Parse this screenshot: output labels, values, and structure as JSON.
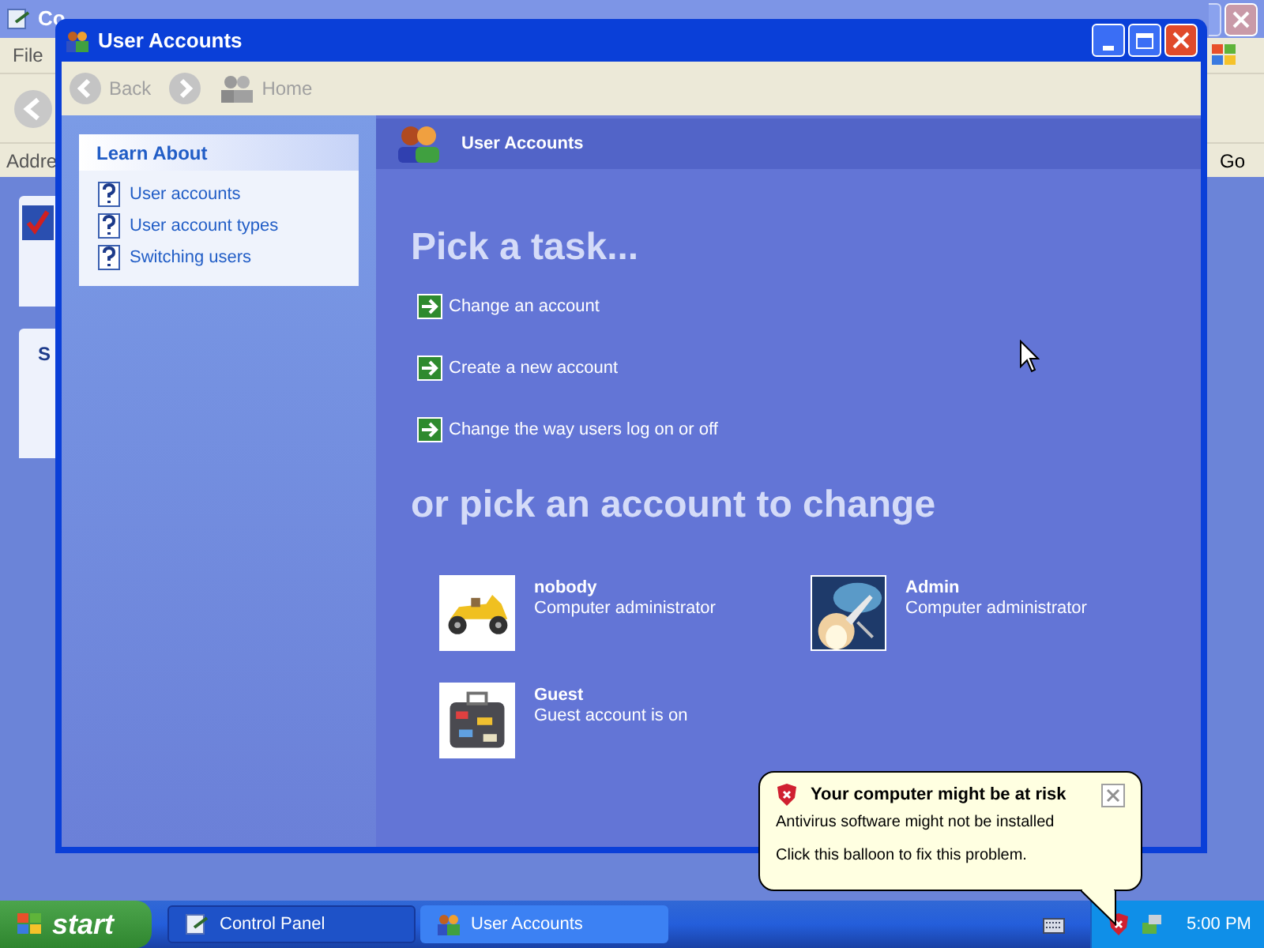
{
  "background_window": {
    "title": "Co",
    "menu": [
      "File"
    ],
    "address_label": "Addre",
    "go_button": "Go",
    "panel_heading": "S"
  },
  "window": {
    "title": "User Accounts",
    "toolbar": [
      {
        "kind": "back",
        "label": "Back",
        "disabled": true
      },
      {
        "kind": "forward",
        "disabled": true
      },
      {
        "kind": "home",
        "label": "Home",
        "disabled": true
      }
    ],
    "learn_about": {
      "title": "Learn About",
      "items": [
        "User accounts",
        "User account types",
        "Switching users"
      ]
    },
    "header": "User Accounts",
    "task_heading": "Pick a task...",
    "tasks": [
      "Change an account",
      "Create a new account",
      "Change the way users log on or off"
    ],
    "account_heading": "or pick an account to change",
    "accounts": [
      {
        "name": "nobody",
        "description": "Computer administrator",
        "kind": "car"
      },
      {
        "name": "Admin",
        "description": "Computer administrator",
        "kind": "rocket"
      },
      {
        "name": "Guest",
        "description": "Guest account is on",
        "kind": "suitcase"
      }
    ]
  },
  "balloon": {
    "title": "Your computer might be at risk",
    "lines": [
      "Antivirus software might not be installed",
      "Click this balloon to fix this problem."
    ]
  },
  "taskbar": {
    "start": "start",
    "buttons": [
      {
        "label": "Control Panel",
        "selected": false
      },
      {
        "label": "User Accounts",
        "selected": true
      }
    ],
    "clock": "5:00 PM"
  }
}
